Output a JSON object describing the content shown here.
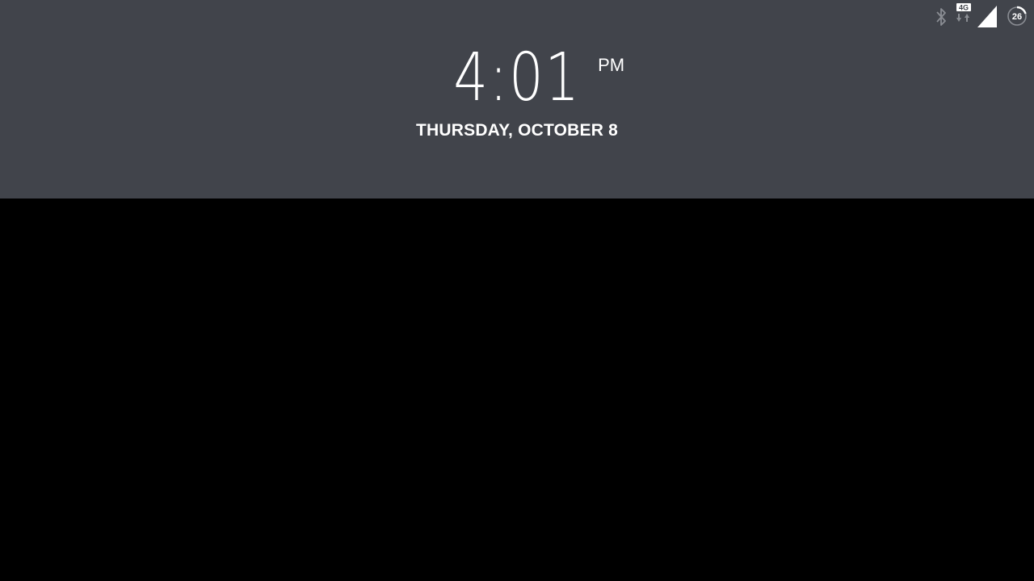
{
  "status_bar": {
    "icons": [
      "bluetooth-icon",
      "mobile-data-4g-icon",
      "cell-signal-icon",
      "battery-icon"
    ],
    "network_type": "4G",
    "battery_level": "26"
  },
  "lockscreen": {
    "time": "4:01",
    "ampm": "PM",
    "date": "THURSDAY, OCTOBER 8"
  },
  "colors": {
    "header_background": "#41444b",
    "screen_background": "#000000",
    "text": "#ffffff"
  }
}
